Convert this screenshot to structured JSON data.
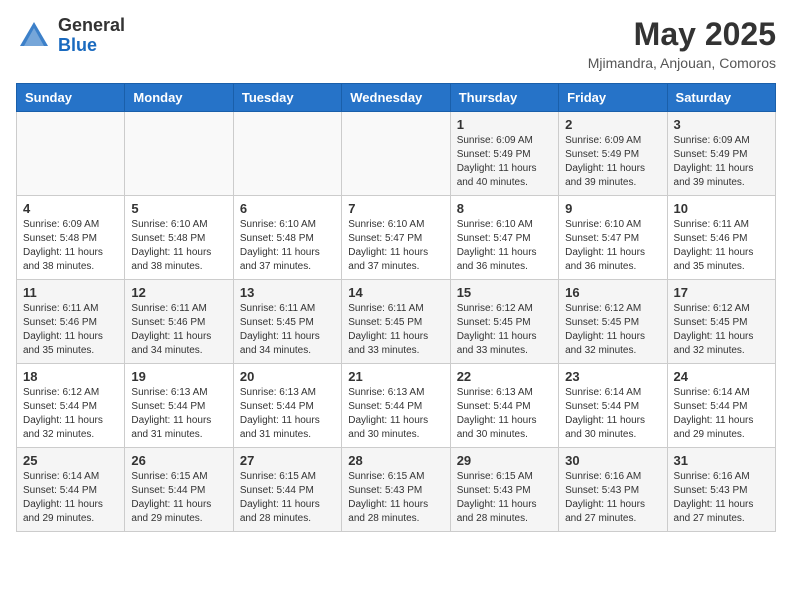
{
  "header": {
    "logo_general": "General",
    "logo_blue": "Blue",
    "month_title": "May 2025",
    "location": "Mjimandra, Anjouan, Comoros"
  },
  "days_of_week": [
    "Sunday",
    "Monday",
    "Tuesday",
    "Wednesday",
    "Thursday",
    "Friday",
    "Saturday"
  ],
  "weeks": [
    [
      {
        "day": "",
        "info": ""
      },
      {
        "day": "",
        "info": ""
      },
      {
        "day": "",
        "info": ""
      },
      {
        "day": "",
        "info": ""
      },
      {
        "day": "1",
        "info": "Sunrise: 6:09 AM\nSunset: 5:49 PM\nDaylight: 11 hours\nand 40 minutes."
      },
      {
        "day": "2",
        "info": "Sunrise: 6:09 AM\nSunset: 5:49 PM\nDaylight: 11 hours\nand 39 minutes."
      },
      {
        "day": "3",
        "info": "Sunrise: 6:09 AM\nSunset: 5:49 PM\nDaylight: 11 hours\nand 39 minutes."
      }
    ],
    [
      {
        "day": "4",
        "info": "Sunrise: 6:09 AM\nSunset: 5:48 PM\nDaylight: 11 hours\nand 38 minutes."
      },
      {
        "day": "5",
        "info": "Sunrise: 6:10 AM\nSunset: 5:48 PM\nDaylight: 11 hours\nand 38 minutes."
      },
      {
        "day": "6",
        "info": "Sunrise: 6:10 AM\nSunset: 5:48 PM\nDaylight: 11 hours\nand 37 minutes."
      },
      {
        "day": "7",
        "info": "Sunrise: 6:10 AM\nSunset: 5:47 PM\nDaylight: 11 hours\nand 37 minutes."
      },
      {
        "day": "8",
        "info": "Sunrise: 6:10 AM\nSunset: 5:47 PM\nDaylight: 11 hours\nand 36 minutes."
      },
      {
        "day": "9",
        "info": "Sunrise: 6:10 AM\nSunset: 5:47 PM\nDaylight: 11 hours\nand 36 minutes."
      },
      {
        "day": "10",
        "info": "Sunrise: 6:11 AM\nSunset: 5:46 PM\nDaylight: 11 hours\nand 35 minutes."
      }
    ],
    [
      {
        "day": "11",
        "info": "Sunrise: 6:11 AM\nSunset: 5:46 PM\nDaylight: 11 hours\nand 35 minutes."
      },
      {
        "day": "12",
        "info": "Sunrise: 6:11 AM\nSunset: 5:46 PM\nDaylight: 11 hours\nand 34 minutes."
      },
      {
        "day": "13",
        "info": "Sunrise: 6:11 AM\nSunset: 5:45 PM\nDaylight: 11 hours\nand 34 minutes."
      },
      {
        "day": "14",
        "info": "Sunrise: 6:11 AM\nSunset: 5:45 PM\nDaylight: 11 hours\nand 33 minutes."
      },
      {
        "day": "15",
        "info": "Sunrise: 6:12 AM\nSunset: 5:45 PM\nDaylight: 11 hours\nand 33 minutes."
      },
      {
        "day": "16",
        "info": "Sunrise: 6:12 AM\nSunset: 5:45 PM\nDaylight: 11 hours\nand 32 minutes."
      },
      {
        "day": "17",
        "info": "Sunrise: 6:12 AM\nSunset: 5:45 PM\nDaylight: 11 hours\nand 32 minutes."
      }
    ],
    [
      {
        "day": "18",
        "info": "Sunrise: 6:12 AM\nSunset: 5:44 PM\nDaylight: 11 hours\nand 32 minutes."
      },
      {
        "day": "19",
        "info": "Sunrise: 6:13 AM\nSunset: 5:44 PM\nDaylight: 11 hours\nand 31 minutes."
      },
      {
        "day": "20",
        "info": "Sunrise: 6:13 AM\nSunset: 5:44 PM\nDaylight: 11 hours\nand 31 minutes."
      },
      {
        "day": "21",
        "info": "Sunrise: 6:13 AM\nSunset: 5:44 PM\nDaylight: 11 hours\nand 30 minutes."
      },
      {
        "day": "22",
        "info": "Sunrise: 6:13 AM\nSunset: 5:44 PM\nDaylight: 11 hours\nand 30 minutes."
      },
      {
        "day": "23",
        "info": "Sunrise: 6:14 AM\nSunset: 5:44 PM\nDaylight: 11 hours\nand 30 minutes."
      },
      {
        "day": "24",
        "info": "Sunrise: 6:14 AM\nSunset: 5:44 PM\nDaylight: 11 hours\nand 29 minutes."
      }
    ],
    [
      {
        "day": "25",
        "info": "Sunrise: 6:14 AM\nSunset: 5:44 PM\nDaylight: 11 hours\nand 29 minutes."
      },
      {
        "day": "26",
        "info": "Sunrise: 6:15 AM\nSunset: 5:44 PM\nDaylight: 11 hours\nand 29 minutes."
      },
      {
        "day": "27",
        "info": "Sunrise: 6:15 AM\nSunset: 5:44 PM\nDaylight: 11 hours\nand 28 minutes."
      },
      {
        "day": "28",
        "info": "Sunrise: 6:15 AM\nSunset: 5:43 PM\nDaylight: 11 hours\nand 28 minutes."
      },
      {
        "day": "29",
        "info": "Sunrise: 6:15 AM\nSunset: 5:43 PM\nDaylight: 11 hours\nand 28 minutes."
      },
      {
        "day": "30",
        "info": "Sunrise: 6:16 AM\nSunset: 5:43 PM\nDaylight: 11 hours\nand 27 minutes."
      },
      {
        "day": "31",
        "info": "Sunrise: 6:16 AM\nSunset: 5:43 PM\nDaylight: 11 hours\nand 27 minutes."
      }
    ]
  ]
}
